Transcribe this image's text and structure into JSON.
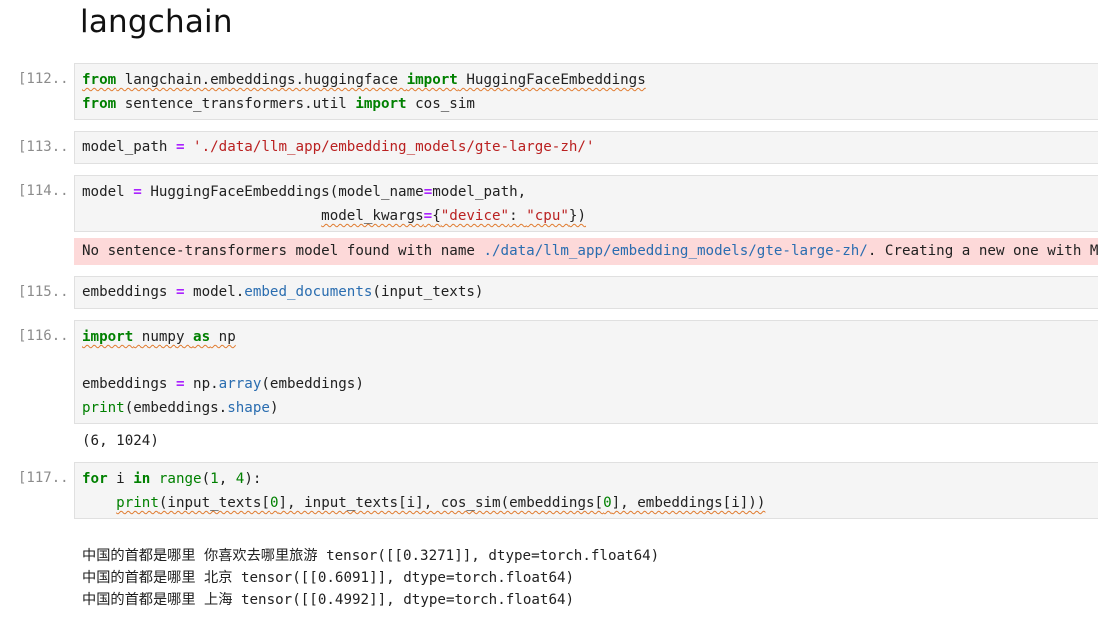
{
  "notebook": {
    "heading": "langchain",
    "cells": [
      {
        "prompt": "[112...",
        "lines": [
          {
            "kw1": "from",
            "mod": " langchain.embeddings.huggingface ",
            "kw2": "import",
            "name": " HuggingFaceEmbeddings"
          },
          {
            "kw1": "from",
            "mod": " sentence_transformers.util ",
            "kw2": "import",
            "name": " cos_sim"
          }
        ]
      },
      {
        "prompt": "[113...",
        "var": "model_path",
        "eq": " = ",
        "str": "'./data/llm_app/embedding_models/gte-large-zh/'"
      },
      {
        "prompt": "[114...",
        "l1_a": "model",
        "l1_eq": " = ",
        "l1_b": "HuggingFaceEmbeddings(model_name",
        "l1_eq2": "=",
        "l1_c": "model_path,",
        "l2_indent": "                            ",
        "l2_a": "model_kwargs",
        "l2_eq": "=",
        "l2_b": "{",
        "l2_s1": "\"device\"",
        "l2_c": ": ",
        "l2_s2": "\"cpu\"",
        "l2_d": "})",
        "stderr_a": "No sentence-transformers model found with name ",
        "stderr_path": "./data/llm_app/embedding_models/gte-large-zh/",
        "stderr_b": ". Creating a new one with MEAN pooling."
      },
      {
        "prompt": "[115...",
        "a": "embeddings",
        "eq": " = ",
        "b": "model.",
        "method": "embed_documents",
        "c": "(input_texts)"
      },
      {
        "prompt": "[116...",
        "l1_kw": "import",
        "l1_a": " numpy ",
        "l1_kw2": "as",
        "l1_b": " np",
        "l3_a": "embeddings",
        "l3_eq": " = ",
        "l3_b": "np.",
        "l3_m": "array",
        "l3_c": "(embeddings)",
        "l4_fn": "print",
        "l4_a": "(embeddings.",
        "l4_attr": "shape",
        "l4_b": ")",
        "output": "(6, 1024)"
      },
      {
        "prompt": "[117...",
        "l1_kw": "for",
        "l1_a": " i ",
        "l1_kw2": "in",
        "l1_sp": " ",
        "l1_fn": "range",
        "l1_b": "(",
        "l1_n1": "1",
        "l1_c": ", ",
        "l1_n2": "4",
        "l1_d": "):",
        "l2_indent": "    ",
        "l2_fn": "print",
        "l2_a": "(input_texts[",
        "l2_n1": "0",
        "l2_b": "], input_texts[i], cos_sim(embeddings[",
        "l2_n2": "0",
        "l2_c": "], embeddings[i]))",
        "outputs": [
          "中国的首都是哪里 你喜欢去哪里旅游 tensor([[0.3271]], dtype=torch.float64)",
          "中国的首都是哪里 北京 tensor([[0.6091]], dtype=torch.float64)",
          "中国的首都是哪里 上海 tensor([[0.4992]], dtype=torch.float64)"
        ]
      }
    ]
  }
}
